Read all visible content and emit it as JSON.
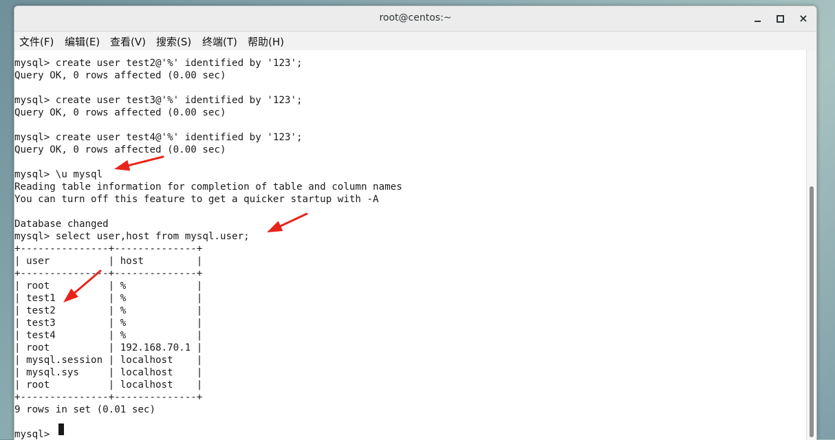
{
  "window": {
    "title": "root@centos:~",
    "controls": {
      "minimize": "minimize",
      "maximize": "maximize",
      "close": "×"
    }
  },
  "menu": [
    "文件(F)",
    "编辑(E)",
    "查看(V)",
    "搜索(S)",
    "终端(T)",
    "帮助(H)"
  ],
  "terminal": {
    "lines": [
      "mysql> create user test2@'%' identified by '123';",
      "Query OK, 0 rows affected (0.00 sec)",
      "",
      "mysql> create user test3@'%' identified by '123';",
      "Query OK, 0 rows affected (0.00 sec)",
      "",
      "mysql> create user test4@'%' identified by '123';",
      "Query OK, 0 rows affected (0.00 sec)",
      "",
      "mysql> \\u mysql",
      "Reading table information for completion of table and column names",
      "You can turn off this feature to get a quicker startup with -A",
      "",
      "Database changed",
      "mysql> select user,host from mysql.user;",
      "+---------------+--------------+",
      "| user          | host         |",
      "+---------------+--------------+",
      "| root          | %            |",
      "| test1         | %            |",
      "| test2         | %            |",
      "| test3         | %            |",
      "| test4         | %            |",
      "| root          | 192.168.70.1 |",
      "| mysql.session | localhost    |",
      "| mysql.sys     | localhost    |",
      "| root          | localhost    |",
      "+---------------+--------------+",
      "9 rows in set (0.01 sec)",
      "",
      "mysql> "
    ]
  },
  "annotations": {
    "arrow_color": "#e8231a"
  },
  "colors": {
    "terminal_bg": "#ffffff",
    "terminal_fg": "#1a1a1a",
    "titlebar_bg": "#ececec"
  }
}
